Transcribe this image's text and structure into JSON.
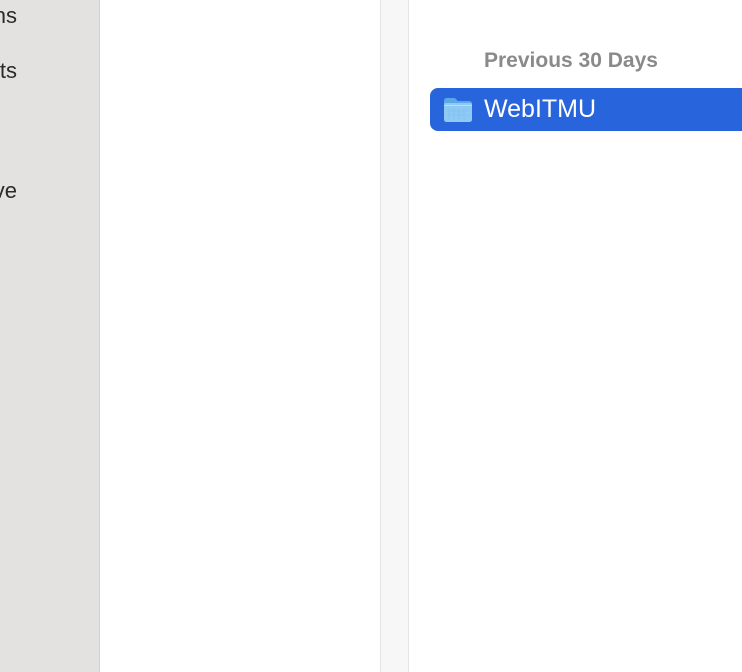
{
  "sidebar": {
    "items": [
      {
        "label": "Applications"
      },
      {
        "label": "Documents"
      },
      {
        "label": "iCloud Drive"
      }
    ]
  },
  "browser": {
    "section_header": "Previous 30 Days",
    "rows": [
      {
        "label": "WebITMU",
        "icon": "folder-icon",
        "selected": true
      }
    ]
  },
  "colors": {
    "selection": "#2864dc",
    "sidebar_bg": "#e3e2e1",
    "header_text": "#8a8a8a"
  }
}
